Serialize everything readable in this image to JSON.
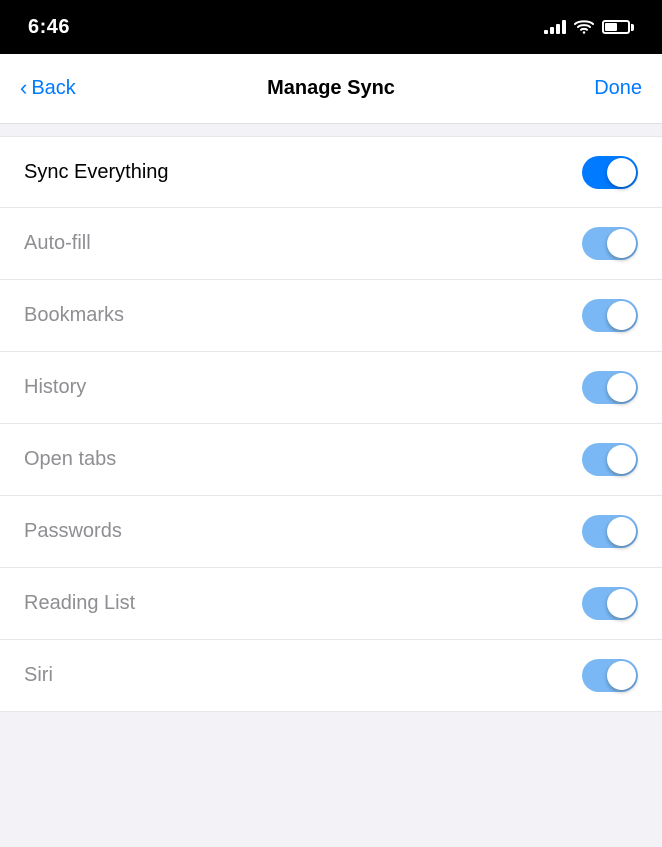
{
  "statusBar": {
    "time": "6:46"
  },
  "navBar": {
    "backLabel": "Back",
    "title": "Manage Sync",
    "doneLabel": "Done"
  },
  "settings": {
    "rows": [
      {
        "id": "sync-everything",
        "label": "Sync Everything",
        "dimmed": false,
        "state": "on-blue"
      },
      {
        "id": "auto-fill",
        "label": "Auto-fill",
        "dimmed": true,
        "state": "on-light-blue"
      },
      {
        "id": "bookmarks",
        "label": "Bookmarks",
        "dimmed": true,
        "state": "on-light-blue"
      },
      {
        "id": "history",
        "label": "History",
        "dimmed": true,
        "state": "on-light-blue"
      },
      {
        "id": "open-tabs",
        "label": "Open tabs",
        "dimmed": true,
        "state": "on-light-blue"
      },
      {
        "id": "passwords",
        "label": "Passwords",
        "dimmed": true,
        "state": "on-light-blue"
      },
      {
        "id": "reading-list",
        "label": "Reading List",
        "dimmed": true,
        "state": "on-light-blue"
      },
      {
        "id": "siri",
        "label": "Siri",
        "dimmed": true,
        "state": "on-light-blue"
      }
    ]
  }
}
